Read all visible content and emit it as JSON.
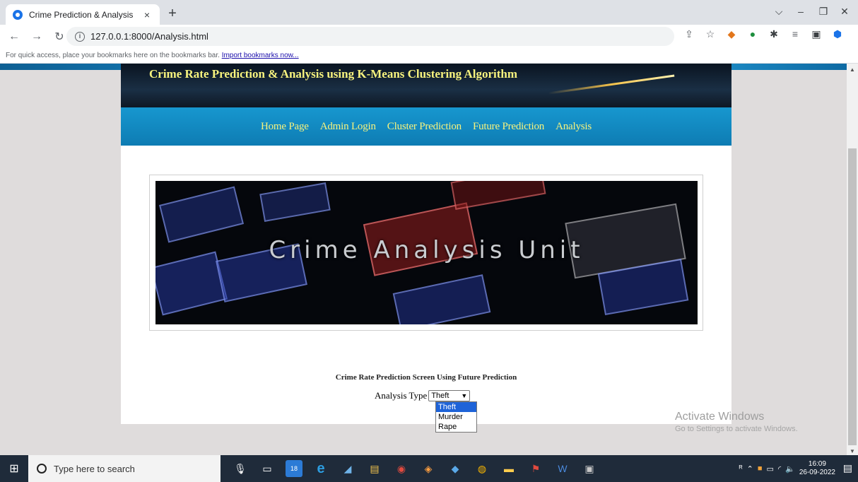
{
  "browser": {
    "tab_title": "Crime Prediction & Analysis",
    "tab_close": "×",
    "new_tab": "+",
    "url": "127.0.0.1:8000/Analysis.html",
    "bookmarks_text": "For quick access, place your bookmarks here on the bookmarks bar.",
    "bookmarks_link": "Import bookmarks now..."
  },
  "page": {
    "header_title": "Crime Rate Prediction & Analysis using K-Means Clustering Algorithm",
    "nav": [
      "Home Page",
      "Admin Login",
      "Cluster Prediction",
      "Future Prediction",
      "Analysis"
    ],
    "banner_text": "Crime Analysis Unit",
    "screen_title": "Crime Rate Prediction Screen Using Future Prediction",
    "analysis_label": "Analysis Type",
    "selected": "Theft",
    "options": [
      "Theft",
      "Murder",
      "Rape"
    ]
  },
  "watermark": {
    "line1": "Activate Windows",
    "line2": "Go to Settings to activate Windows."
  },
  "taskbar": {
    "search_placeholder": "Type here to search",
    "mail_badge": "18",
    "time": "16:09",
    "date": "26-09-2022"
  }
}
